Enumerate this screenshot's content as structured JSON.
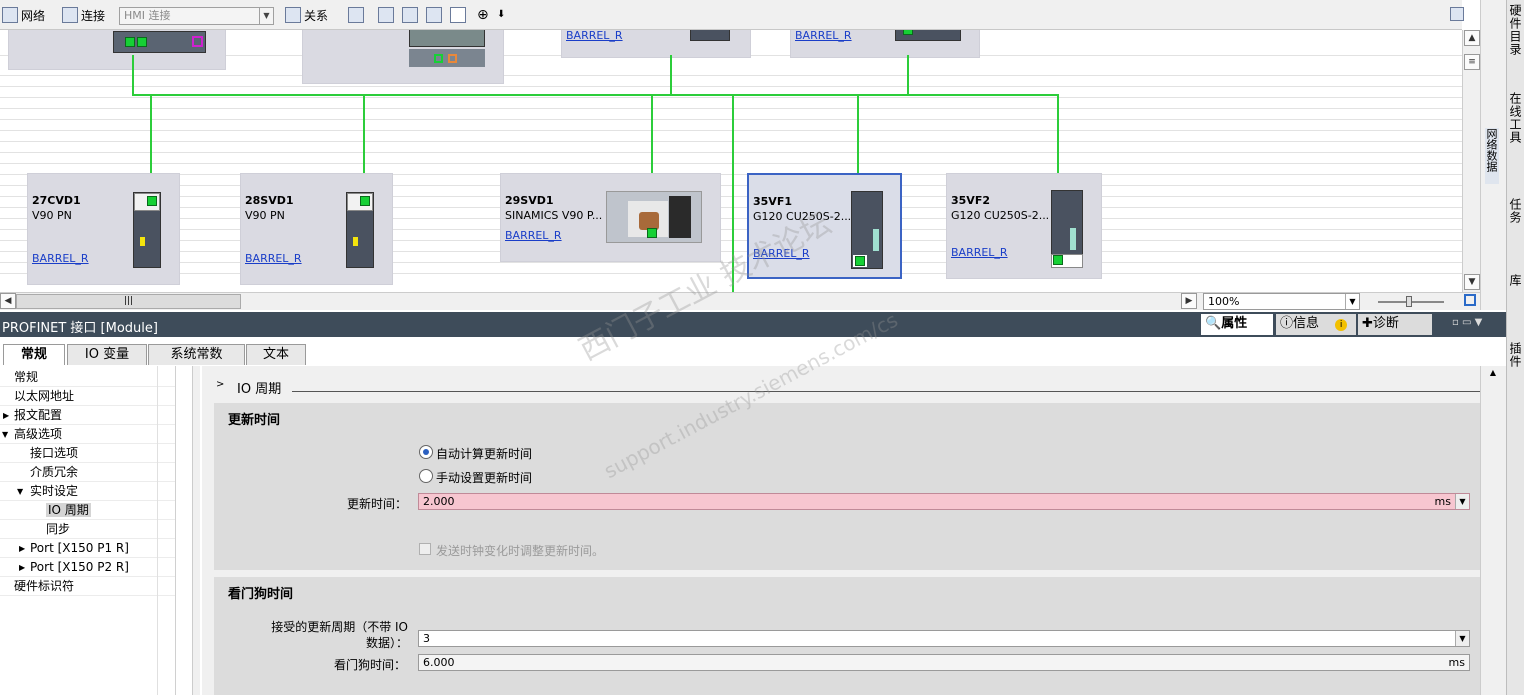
{
  "toolbar": {
    "network_label": "网络",
    "connect_label": "连接",
    "connection_type": "HMI 连接",
    "relation_label": "关系"
  },
  "devices_top": [
    {
      "link": "BARREL_R"
    },
    {
      "link": "BARREL_R"
    }
  ],
  "devices": [
    {
      "name": "27CVD1",
      "type": "V90 PN",
      "link": "BARREL_R"
    },
    {
      "name": "28SVD1",
      "type": "V90 PN",
      "link": "BARREL_R"
    },
    {
      "name": "29SVD1",
      "type": "SINAMICS V90 P...",
      "link": "BARREL_R"
    },
    {
      "name": "35VF1",
      "type": "G120 CU250S-2...",
      "link": "BARREL_R"
    },
    {
      "name": "35VF2",
      "type": "G120 CU250S-2...",
      "link": "BARREL_R"
    }
  ],
  "zoom": "100%",
  "right_tabs": [
    "硬件目录",
    "在线工具",
    "任务",
    "库",
    "插件"
  ],
  "network_data_tab": "网络数据",
  "panel": {
    "title": "PROFINET 接口 [Module]",
    "props_tab": "属性",
    "info_tab": "信息",
    "diag_tab": "诊断"
  },
  "tabs": [
    "常规",
    "IO 变量",
    "系统常数",
    "文本"
  ],
  "nav": [
    "常规",
    "以太网地址",
    "报文配置",
    "高级选项",
    "接口选项",
    "介质冗余",
    "实时设定",
    "IO 周期",
    "同步",
    "Port [X150 P1 R]",
    "Port [X150 P2 R]",
    "硬件标识符"
  ],
  "content": {
    "breadcrumb": "IO 周期",
    "update_section": "更新时间",
    "auto_calc": "自动计算更新时间",
    "manual_set": "手动设置更新时间",
    "update_time_label": "更新时间：",
    "update_time_value": "2.000",
    "unit_ms": "ms",
    "adjust_checkbox": "发送时钟变化时调整更新时间。",
    "watchdog_section": "看门狗时间",
    "accepted_cycles_label": "接受的更新周期（不带 IO 数据）：",
    "accepted_cycles_value": "3",
    "watchdog_label": "看门狗时间：",
    "watchdog_value": "6.000",
    "watchdog_unit": "ms"
  },
  "watermark": {
    "line1": "西门子工业 技术论坛",
    "line2": "support.industry.siemens.com/cs"
  }
}
